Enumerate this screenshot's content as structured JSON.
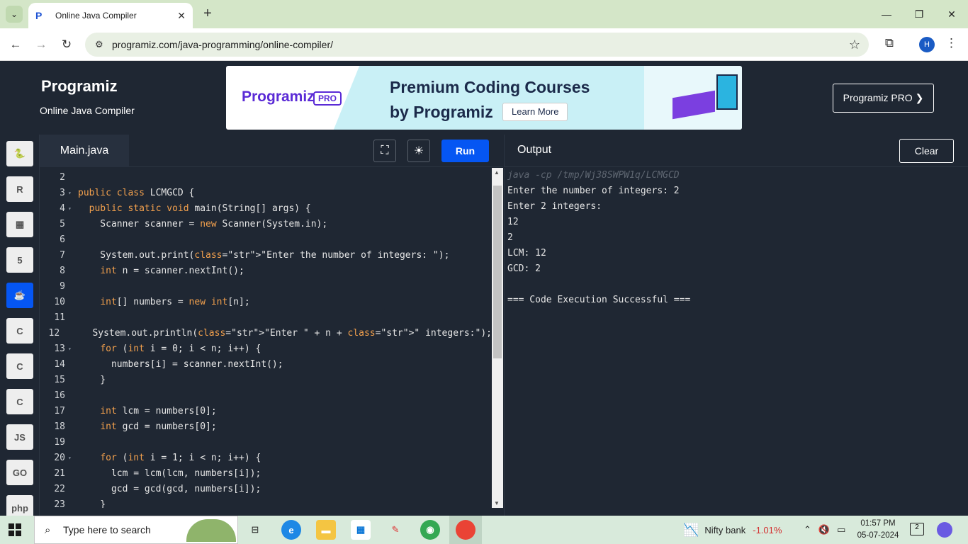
{
  "browser": {
    "tab_title": "Online Java Compiler",
    "url": "programiz.com/java-programming/online-compiler/",
    "avatar_letter": "H"
  },
  "header": {
    "logo": "Programiz",
    "subtitle": "Online Java Compiler",
    "banner_logo": "Programiz",
    "banner_pro": "PRO",
    "banner_line1": "Premium Coding Courses",
    "banner_line2": "by Programiz",
    "banner_button": "Learn More",
    "pro_button": "Programiz PRO ❯"
  },
  "languages": [
    {
      "name": "python-icon",
      "glyph": "🐍"
    },
    {
      "name": "r-icon",
      "glyph": "R"
    },
    {
      "name": "sql-icon",
      "glyph": "▦"
    },
    {
      "name": "html-icon",
      "glyph": "5"
    },
    {
      "name": "java-icon",
      "glyph": "☕",
      "active": true
    },
    {
      "name": "c-icon",
      "glyph": "C"
    },
    {
      "name": "cpp-icon",
      "glyph": "C"
    },
    {
      "name": "csharp-icon",
      "glyph": "C"
    },
    {
      "name": "js-icon",
      "glyph": "JS"
    },
    {
      "name": "go-icon",
      "glyph": "GO"
    },
    {
      "name": "php-icon",
      "glyph": "php"
    }
  ],
  "editor": {
    "file_name": "Main.java",
    "run_label": "Run",
    "lines": [
      {
        "n": "2",
        "fold": "",
        "code": ""
      },
      {
        "n": "3",
        "fold": "▾",
        "code": "public class LCMGCD {"
      },
      {
        "n": "4",
        "fold": "▾",
        "code": "  public static void main(String[] args) {"
      },
      {
        "n": "5",
        "fold": "",
        "code": "    Scanner scanner = new Scanner(System.in);"
      },
      {
        "n": "6",
        "fold": "",
        "code": ""
      },
      {
        "n": "7",
        "fold": "",
        "code": "    System.out.print(\"Enter the number of integers: \");"
      },
      {
        "n": "8",
        "fold": "",
        "code": "    int n = scanner.nextInt();"
      },
      {
        "n": "9",
        "fold": "",
        "code": ""
      },
      {
        "n": "10",
        "fold": "",
        "code": "    int[] numbers = new int[n];"
      },
      {
        "n": "11",
        "fold": "",
        "code": ""
      },
      {
        "n": "12",
        "fold": "",
        "code": "    System.out.println(\"Enter \" + n + \" integers:\");"
      },
      {
        "n": "13",
        "fold": "▾",
        "code": "    for (int i = 0; i < n; i++) {"
      },
      {
        "n": "14",
        "fold": "",
        "code": "      numbers[i] = scanner.nextInt();"
      },
      {
        "n": "15",
        "fold": "",
        "code": "    }"
      },
      {
        "n": "16",
        "fold": "",
        "code": ""
      },
      {
        "n": "17",
        "fold": "",
        "code": "    int lcm = numbers[0];"
      },
      {
        "n": "18",
        "fold": "",
        "code": "    int gcd = numbers[0];"
      },
      {
        "n": "19",
        "fold": "",
        "code": ""
      },
      {
        "n": "20",
        "fold": "▾",
        "code": "    for (int i = 1; i < n; i++) {"
      },
      {
        "n": "21",
        "fold": "",
        "code": "      lcm = lcm(lcm, numbers[i]);"
      },
      {
        "n": "22",
        "fold": "",
        "code": "      gcd = gcd(gcd, numbers[i]);"
      },
      {
        "n": "23",
        "fold": "",
        "code": "    }"
      }
    ]
  },
  "output": {
    "title": "Output",
    "clear_label": "Clear",
    "lines": [
      {
        "text": "java -cp /tmp/Wj38SWPW1q/LCMGCD",
        "cmd": true
      },
      {
        "text": "Enter the number of integers: 2"
      },
      {
        "text": "Enter 2 integers:"
      },
      {
        "text": "12"
      },
      {
        "text": "2"
      },
      {
        "text": "LCM: 12"
      },
      {
        "text": "GCD: 2"
      },
      {
        "text": ""
      },
      {
        "text": "=== Code Execution Successful ==="
      }
    ]
  },
  "taskbar": {
    "search_placeholder": "Type here to search",
    "nifty_label": "Nifty bank",
    "nifty_value": "-1.01%",
    "time": "01:57 PM",
    "date": "05-07-2024",
    "notifications": "2"
  }
}
